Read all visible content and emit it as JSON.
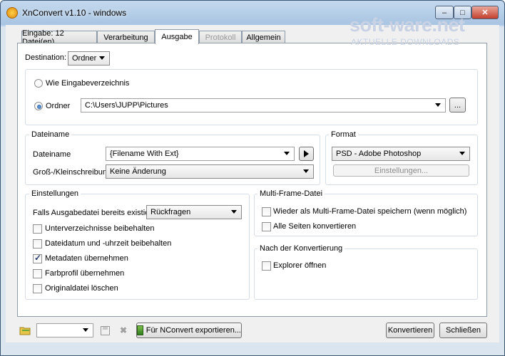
{
  "window": {
    "title": "XnConvert v1.10 - windows",
    "controls": {
      "minimize": "–",
      "maximize": "□",
      "close": "✕"
    }
  },
  "watermark": {
    "main": "soft-ware.net",
    "sub": "AKTUELLE DOWNLOADS"
  },
  "tabs": [
    {
      "label": "Eingabe: 12 Datei(en)",
      "state": "normal"
    },
    {
      "label": "Verarbeitung",
      "state": "normal"
    },
    {
      "label": "Ausgabe",
      "state": "active"
    },
    {
      "label": "Protokoll",
      "state": "disabled"
    },
    {
      "label": "Allgemein",
      "state": "normal"
    }
  ],
  "destination": {
    "label": "Destination:",
    "value": "Ordner",
    "option_same": "Wie Eingabeverzeichnis",
    "option_folder": "Ordner",
    "folder_path": "C:\\Users\\JUPP\\Pictures",
    "browse_label": "..."
  },
  "filename_group": {
    "title": "Dateiname",
    "filename_label": "Dateiname",
    "filename_value": "{Filename With Ext}",
    "case_label": "Groß-/Kleinschreibung",
    "case_value": "Keine Änderung"
  },
  "format_group": {
    "title": "Format",
    "format_value": "PSD - Adobe Photoshop",
    "settings_label": "Einstellungen..."
  },
  "settings_group": {
    "title": "Einstellungen",
    "exists_label": "Falls Ausgabedatei bereits existiert",
    "exists_value": "Rückfragen",
    "keep_subfolders": "Unterverzeichnisse beibehalten",
    "keep_date": "Dateidatum und -uhrzeit beibehalten",
    "copy_metadata": "Metadaten übernehmen",
    "copy_profile": "Farbprofil übernehmen",
    "delete_original": "Originaldatei löschen"
  },
  "multiframe_group": {
    "title": "Multi-Frame-Datei",
    "save_multiframe": "Wieder als Multi-Frame-Datei speichern (wenn möglich)",
    "convert_all_pages": "Alle Seiten konvertieren"
  },
  "after_group": {
    "title": "Nach der Konvertierung",
    "open_explorer": "Explorer öffnen"
  },
  "bottom": {
    "export_label": "Für NConvert exportieren...",
    "convert_label": "Konvertieren",
    "close_label": "Schließen"
  },
  "checkbox_states": {
    "keep_subfolders": false,
    "keep_date": false,
    "copy_metadata": true,
    "copy_profile": false,
    "delete_original": false,
    "save_multiframe": false,
    "convert_all_pages": false,
    "open_explorer": false
  },
  "colors": {
    "title_bar": "#b9d1ea",
    "panel": "#ffffff",
    "dialog": "#f0f0f0",
    "close_button": "#c3402c"
  }
}
